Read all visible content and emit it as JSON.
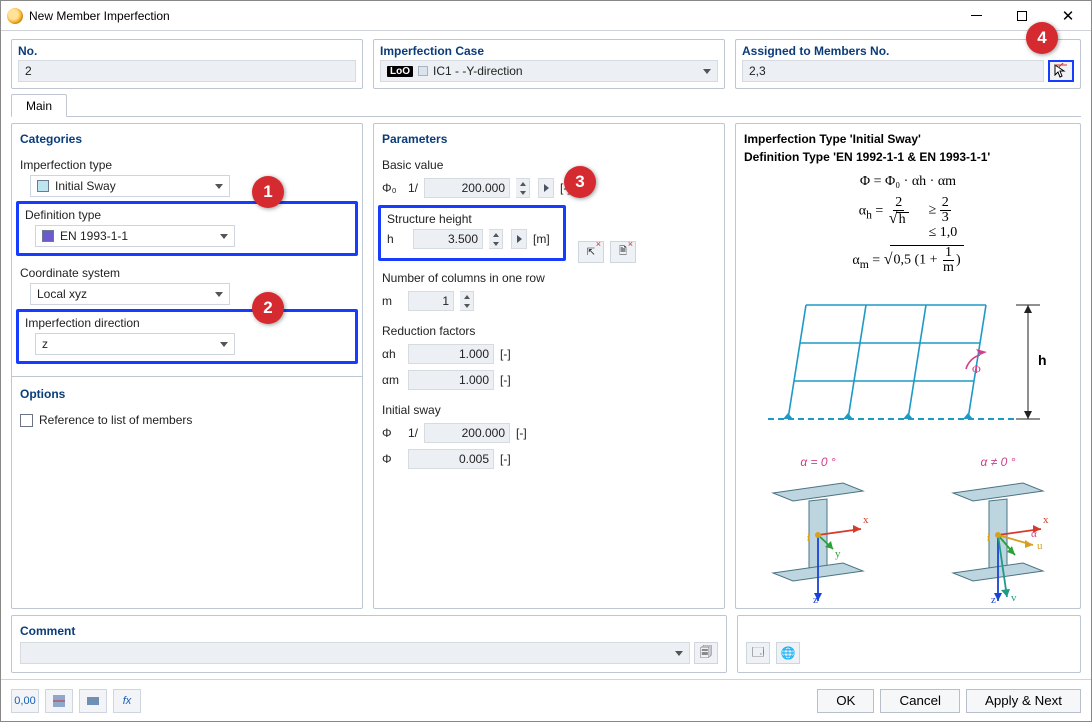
{
  "window": {
    "title": "New Member Imperfection"
  },
  "header": {
    "no": {
      "title": "No.",
      "value": "2"
    },
    "ic": {
      "title": "Imperfection Case",
      "value": "IC1 - -Y-direction",
      "badge": "LoO"
    },
    "assigned": {
      "title": "Assigned to Members No.",
      "value": "2,3"
    }
  },
  "tab": {
    "main": "Main"
  },
  "categories": {
    "title": "Categories",
    "imperfection_type_label": "Imperfection type",
    "imperfection_type_value": "Initial Sway",
    "definition_type_label": "Definition type",
    "definition_type_value": "EN 1993-1-1",
    "coord_label": "Coordinate system",
    "coord_value": "Local xyz",
    "dir_label": "Imperfection direction",
    "dir_value": "z",
    "options_title": "Options",
    "ref_list_label": "Reference to list of members"
  },
  "parameters": {
    "title": "Parameters",
    "basic_value_label": "Basic value",
    "phi0_sym": "Φ₀",
    "one_over": "1/",
    "phi0_val": "200.000",
    "dimless": "[-]",
    "structure_height_label": "Structure height",
    "h_sym": "h",
    "h_val": "3.500",
    "m_unit": "[m]",
    "cols_label": "Number of columns in one row",
    "m_sym": "m",
    "m_val": "1",
    "red_title": "Reduction factors",
    "ah_sym": "αh",
    "ah_val": "1.000",
    "am_sym": "αm",
    "am_val": "1.000",
    "sway_title": "Initial sway",
    "phi_sym": "Φ",
    "phi_inv_val": "200.000",
    "phi_val": "0.005"
  },
  "info": {
    "line1": "Imperfection Type 'Initial Sway'",
    "line2": "Definition Type 'EN 1992-1-1 & EN 1993-1-1'",
    "eq1": "Φ = Φ₀ · αh · αm",
    "beam_left": "α = 0 °",
    "beam_right": "α ≠ 0 °"
  },
  "comment": {
    "title": "Comment"
  },
  "footer": {
    "ok": "OK",
    "cancel": "Cancel",
    "apply": "Apply & Next"
  },
  "badges": {
    "b1": "1",
    "b2": "2",
    "b3": "3",
    "b4": "4"
  }
}
